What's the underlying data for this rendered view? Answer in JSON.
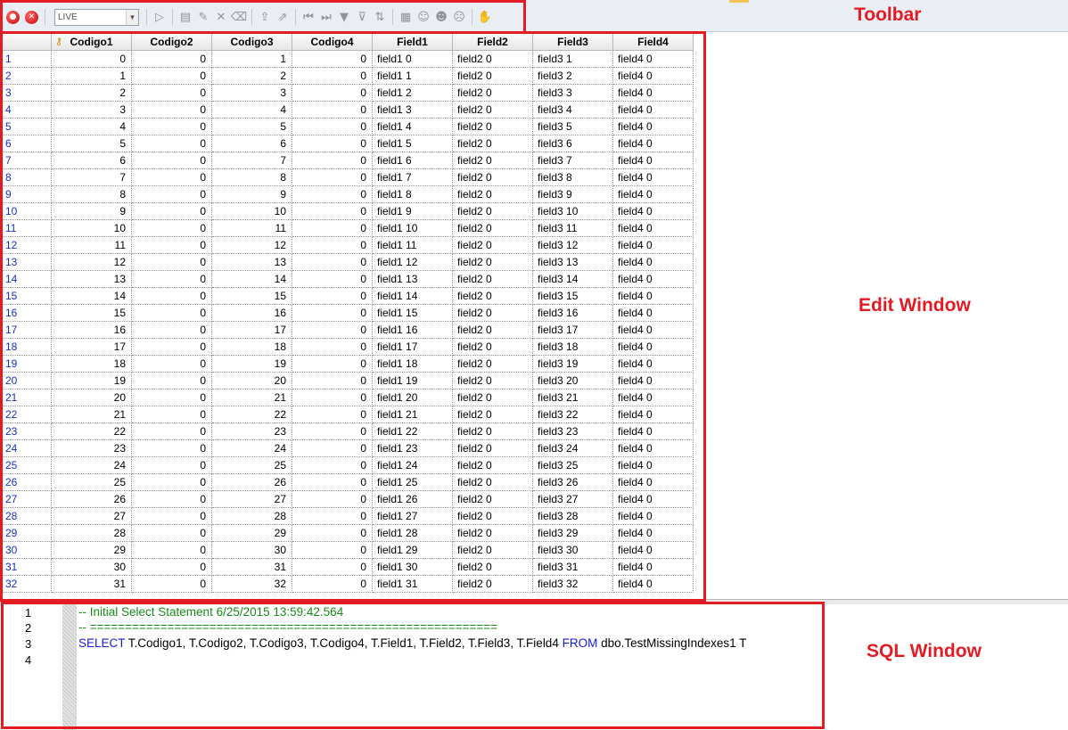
{
  "toolbar": {
    "mode_value": "LIVE",
    "callout_label": "Toolbar"
  },
  "edit_window": {
    "callout_label": "Edit Window",
    "columns": [
      "Codigo1",
      "Codigo2",
      "Codigo3",
      "Codigo4",
      "Field1",
      "Field2",
      "Field3",
      "Field4"
    ],
    "row_indicators": [
      "1",
      "2",
      "3",
      "4",
      "5",
      "6",
      "7",
      "8",
      "9",
      "10",
      "11",
      "12",
      "13",
      "14",
      "15",
      "16",
      "17",
      "18",
      "19",
      "20",
      "21",
      "22",
      "23",
      "24",
      "25",
      "26",
      "27",
      "28",
      "29",
      "30",
      "31",
      "32"
    ],
    "rows": [
      [
        "0",
        "0",
        "1",
        "0",
        "field1 0",
        "field2 0",
        "field3 1",
        "field4 0"
      ],
      [
        "1",
        "0",
        "2",
        "0",
        "field1 1",
        "field2 0",
        "field3 2",
        "field4 0"
      ],
      [
        "2",
        "0",
        "3",
        "0",
        "field1 2",
        "field2 0",
        "field3 3",
        "field4 0"
      ],
      [
        "3",
        "0",
        "4",
        "0",
        "field1 3",
        "field2 0",
        "field3 4",
        "field4 0"
      ],
      [
        "4",
        "0",
        "5",
        "0",
        "field1 4",
        "field2 0",
        "field3 5",
        "field4 0"
      ],
      [
        "5",
        "0",
        "6",
        "0",
        "field1 5",
        "field2 0",
        "field3 6",
        "field4 0"
      ],
      [
        "6",
        "0",
        "7",
        "0",
        "field1 6",
        "field2 0",
        "field3 7",
        "field4 0"
      ],
      [
        "7",
        "0",
        "8",
        "0",
        "field1 7",
        "field2 0",
        "field3 8",
        "field4 0"
      ],
      [
        "8",
        "0",
        "9",
        "0",
        "field1 8",
        "field2 0",
        "field3 9",
        "field4 0"
      ],
      [
        "9",
        "0",
        "10",
        "0",
        "field1 9",
        "field2 0",
        "field3 10",
        "field4 0"
      ],
      [
        "10",
        "0",
        "11",
        "0",
        "field1 10",
        "field2 0",
        "field3 11",
        "field4 0"
      ],
      [
        "11",
        "0",
        "12",
        "0",
        "field1 11",
        "field2 0",
        "field3 12",
        "field4 0"
      ],
      [
        "12",
        "0",
        "13",
        "0",
        "field1 12",
        "field2 0",
        "field3 13",
        "field4 0"
      ],
      [
        "13",
        "0",
        "14",
        "0",
        "field1 13",
        "field2 0",
        "field3 14",
        "field4 0"
      ],
      [
        "14",
        "0",
        "15",
        "0",
        "field1 14",
        "field2 0",
        "field3 15",
        "field4 0"
      ],
      [
        "15",
        "0",
        "16",
        "0",
        "field1 15",
        "field2 0",
        "field3 16",
        "field4 0"
      ],
      [
        "16",
        "0",
        "17",
        "0",
        "field1 16",
        "field2 0",
        "field3 17",
        "field4 0"
      ],
      [
        "17",
        "0",
        "18",
        "0",
        "field1 17",
        "field2 0",
        "field3 18",
        "field4 0"
      ],
      [
        "18",
        "0",
        "19",
        "0",
        "field1 18",
        "field2 0",
        "field3 19",
        "field4 0"
      ],
      [
        "19",
        "0",
        "20",
        "0",
        "field1 19",
        "field2 0",
        "field3 20",
        "field4 0"
      ],
      [
        "20",
        "0",
        "21",
        "0",
        "field1 20",
        "field2 0",
        "field3 21",
        "field4 0"
      ],
      [
        "21",
        "0",
        "22",
        "0",
        "field1 21",
        "field2 0",
        "field3 22",
        "field4 0"
      ],
      [
        "22",
        "0",
        "23",
        "0",
        "field1 22",
        "field2 0",
        "field3 23",
        "field4 0"
      ],
      [
        "23",
        "0",
        "24",
        "0",
        "field1 23",
        "field2 0",
        "field3 24",
        "field4 0"
      ],
      [
        "24",
        "0",
        "25",
        "0",
        "field1 24",
        "field2 0",
        "field3 25",
        "field4 0"
      ],
      [
        "25",
        "0",
        "26",
        "0",
        "field1 25",
        "field2 0",
        "field3 26",
        "field4 0"
      ],
      [
        "26",
        "0",
        "27",
        "0",
        "field1 26",
        "field2 0",
        "field3 27",
        "field4 0"
      ],
      [
        "27",
        "0",
        "28",
        "0",
        "field1 27",
        "field2 0",
        "field3 28",
        "field4 0"
      ],
      [
        "28",
        "0",
        "29",
        "0",
        "field1 28",
        "field2 0",
        "field3 29",
        "field4 0"
      ],
      [
        "29",
        "0",
        "30",
        "0",
        "field1 29",
        "field2 0",
        "field3 30",
        "field4 0"
      ],
      [
        "30",
        "0",
        "31",
        "0",
        "field1 30",
        "field2 0",
        "field3 31",
        "field4 0"
      ],
      [
        "31",
        "0",
        "32",
        "0",
        "field1 31",
        "field2 0",
        "field3 32",
        "field4 0"
      ]
    ]
  },
  "sql_window": {
    "callout_label": "SQL Window",
    "line_numbers": [
      "1",
      "2",
      "3",
      "4"
    ],
    "line1_comment": "-- Initial Select Statement 6/25/2015 13:59:42.564",
    "line2_comment": "-- ==========================================================",
    "line3_kw_select": "SELECT",
    "line3_columns": " T.Codigo1, T.Codigo2, T.Codigo3, T.Codigo4, T.Field1, T.Field2, T.Field3, T.Field4 ",
    "line3_kw_from": "FROM",
    "line3_table": " dbo.TestMissingIndexes1 T"
  },
  "colors": {
    "callout": "#e31b23",
    "comment": "#1a8a1a",
    "keyword": "#1a1ad6",
    "row_indicator": "#1530c8"
  }
}
